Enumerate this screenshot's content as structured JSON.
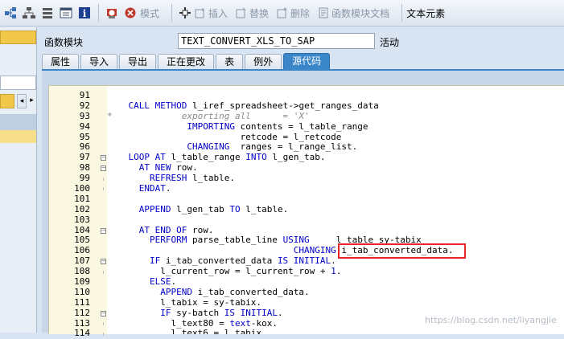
{
  "toolbar": {
    "buttons": [
      {
        "icon": "display-object-list-icon",
        "label": "模式",
        "enabled": false
      },
      {
        "icon": "insert-icon",
        "label": "插入",
        "enabled": false
      },
      {
        "icon": "replace-icon",
        "label": "替换",
        "enabled": false
      },
      {
        "icon": "delete-icon",
        "label": "删除",
        "enabled": false
      },
      {
        "icon": "function-module-doc-icon",
        "label": "函数模块文档",
        "enabled": false
      },
      {
        "icon": "text-elements-icon",
        "label": "文本元素",
        "enabled": true
      }
    ]
  },
  "header": {
    "field_label": "函数模块",
    "function_name": "TEXT_CONVERT_XLS_TO_SAP",
    "status": "活动"
  },
  "tabs": [
    {
      "label": "属性",
      "active": false
    },
    {
      "label": "导入",
      "active": false
    },
    {
      "label": "导出",
      "active": false
    },
    {
      "label": "正在更改",
      "active": false
    },
    {
      "label": "表",
      "active": false
    },
    {
      "label": "例外",
      "active": false
    },
    {
      "label": "源代码",
      "active": true
    }
  ],
  "editor": {
    "line_numbers": [
      "91",
      "92",
      "93",
      "94",
      "95",
      "96",
      "97",
      "98",
      "99",
      "100",
      "101",
      "102",
      "103",
      "104",
      "105",
      "106",
      "107",
      "108",
      "109",
      "110",
      "111",
      "112",
      "113",
      "114"
    ],
    "highlighted_text": "i_tab_converted_data."
  },
  "watermark": "https://blog.csdn.net/liyangjie",
  "colors": {
    "active_tab": "#3a86c9",
    "keyword": "#0000c8",
    "highlight_box": "#e8252b"
  }
}
